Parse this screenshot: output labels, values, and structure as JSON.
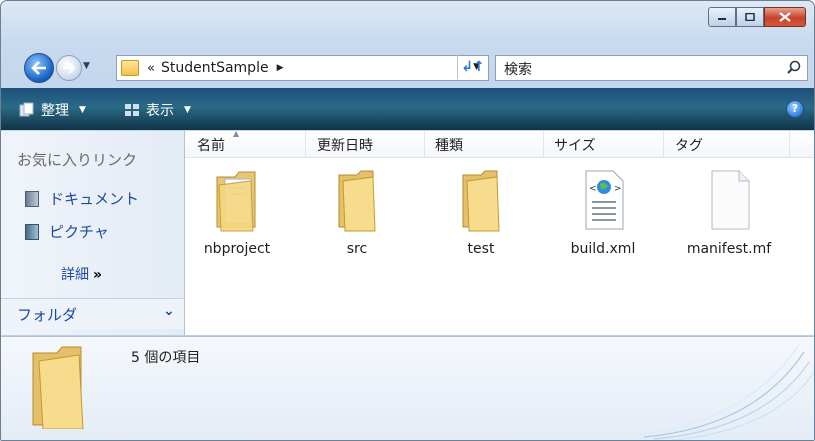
{
  "window": {
    "caption_buttons": [
      "minimize",
      "maximize",
      "close"
    ]
  },
  "address": {
    "chevrons": "«",
    "path": "StudentSample",
    "search_placeholder": "検索"
  },
  "toolbar": {
    "organize": "整理",
    "views": "表示"
  },
  "nav": {
    "favorites_title": "お気に入りリンク",
    "links": [
      {
        "label": "ドキュメント",
        "icon": "documents-icon"
      },
      {
        "label": "ピクチャ",
        "icon": "pictures-icon"
      }
    ],
    "more": "詳細",
    "more_chevrons": "»",
    "folders": "フォルダ"
  },
  "columns": [
    "名前",
    "更新日時",
    "種類",
    "サイズ",
    "タグ"
  ],
  "items": [
    {
      "name": "nbproject",
      "icon": "folder-with-files-icon"
    },
    {
      "name": "src",
      "icon": "folder-icon"
    },
    {
      "name": "test",
      "icon": "folder-icon"
    },
    {
      "name": "build.xml",
      "icon": "xml-file-icon"
    },
    {
      "name": "manifest.mf",
      "icon": "blank-file-icon"
    }
  ],
  "details": {
    "count_text": "5 個の項目"
  },
  "colors": {
    "toolbar": "#1f4f7c",
    "link": "#1b4aa5",
    "folder": "#f1c24a"
  }
}
